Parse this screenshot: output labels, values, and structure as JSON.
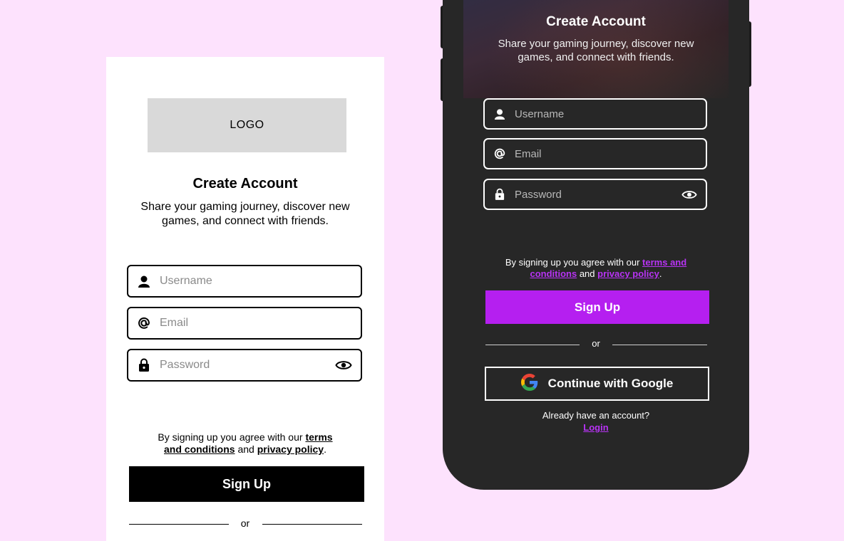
{
  "wireframe": {
    "logo_text": "LOGO",
    "title": "Create Account",
    "subtitle": "Share your gaming journey, discover new games, and connect with friends.",
    "username_placeholder": "Username",
    "email_placeholder": "Email",
    "password_placeholder": "Password",
    "terms_prefix": "By signing up you agree with our ",
    "terms_link": "terms and conditions",
    "terms_and": " and ",
    "privacy_link": "privacy policy",
    "terms_suffix": ".",
    "signup_label": "Sign Up",
    "or_label": "or"
  },
  "phone": {
    "title": "Create Account",
    "subtitle": "Share your gaming journey, discover new games, and connect with friends.",
    "username_placeholder": "Username",
    "email_placeholder": "Email",
    "password_placeholder": "Password",
    "terms_prefix": "By signing up you agree with our ",
    "terms_link": "terms and conditions",
    "terms_and": " and ",
    "privacy_link": "privacy policy",
    "terms_suffix": ".",
    "signup_label": "Sign Up",
    "or_label": "or",
    "google_label": "Continue with Google",
    "already_text": "Already have an account?",
    "login_label": "Login"
  },
  "colors": {
    "background": "#fde2fd",
    "accent": "#b51ff0",
    "phone_body": "#272727"
  },
  "icons": [
    "user-icon",
    "at-icon",
    "lock-icon",
    "eye-icon",
    "google-icon"
  ]
}
